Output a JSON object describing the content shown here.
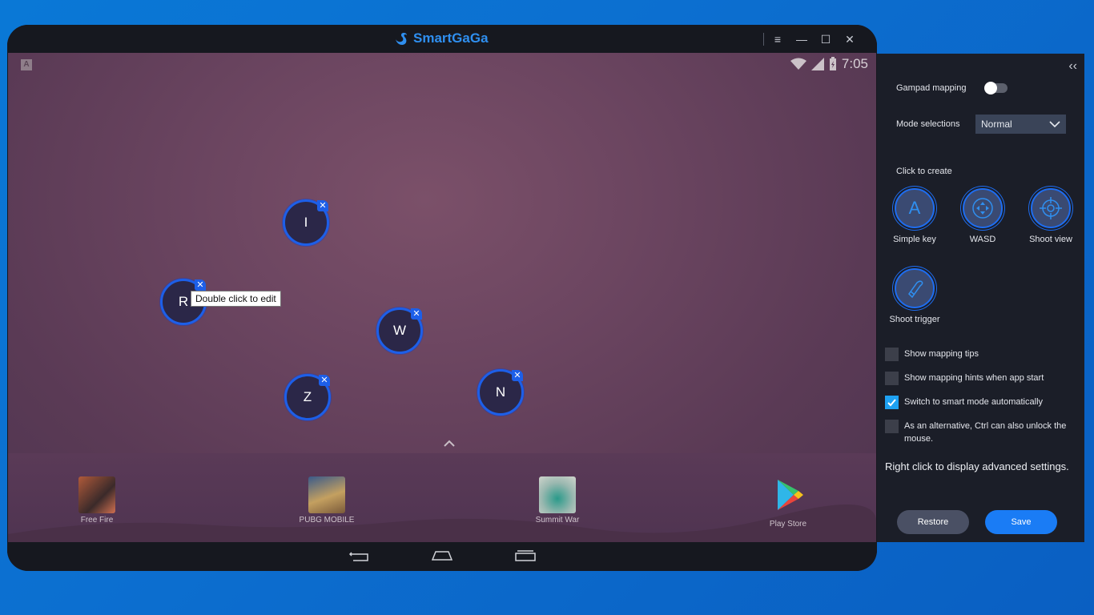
{
  "window": {
    "brand": "SmartGaGa",
    "controls": {
      "menu": "≡",
      "minimize": "—",
      "maximize": "☐",
      "close": "✕"
    }
  },
  "status_bar": {
    "keyboard_indicator": "A",
    "time": "7:05"
  },
  "mapped_keys": [
    {
      "label": "I",
      "remove": "✕"
    },
    {
      "label": "R",
      "remove": "✕"
    },
    {
      "label": "W",
      "remove": "✕"
    },
    {
      "label": "Z",
      "remove": "✕"
    },
    {
      "label": "N",
      "remove": "✕"
    }
  ],
  "tooltip": "Double click to edit",
  "apps": [
    {
      "label": "Free Fire",
      "icon": "free-fire-icon"
    },
    {
      "label": "PUBG MOBILE",
      "icon": "pubg-mobile-icon"
    },
    {
      "label": "Summit War",
      "icon": "summit-war-icon"
    },
    {
      "label": "Play Store",
      "icon": "play-store-icon"
    }
  ],
  "panel": {
    "collapse": "‹‹",
    "gamepad_mapping_label": "Gampad mapping",
    "gamepad_mapping_on": false,
    "mode_label": "Mode selections",
    "mode_value": "Normal",
    "create_label": "Click to create",
    "tools": [
      {
        "label": "Simple key",
        "glyph": "A",
        "icon": "simple-key-icon"
      },
      {
        "label": "WASD",
        "icon": "dpad-icon"
      },
      {
        "label": "Shoot view",
        "icon": "crosshair-icon"
      },
      {
        "label": "Shoot trigger",
        "icon": "bullet-icon"
      }
    ],
    "checkboxes": [
      {
        "label": "Show mapping tips",
        "checked": false
      },
      {
        "label": "Show mapping hints when app start",
        "checked": false
      },
      {
        "label": "Switch to smart mode automatically",
        "checked": true
      },
      {
        "label": "As an alternative, Ctrl can also unlock the mouse.",
        "checked": false
      }
    ],
    "advanced_hint": "Right click to display advanced settings.",
    "restore_label": "Restore",
    "save_label": "Save"
  },
  "colors": {
    "accent": "#1a7cf5",
    "key_border": "#1d5fe8",
    "panel_bg": "#1b1e28"
  }
}
